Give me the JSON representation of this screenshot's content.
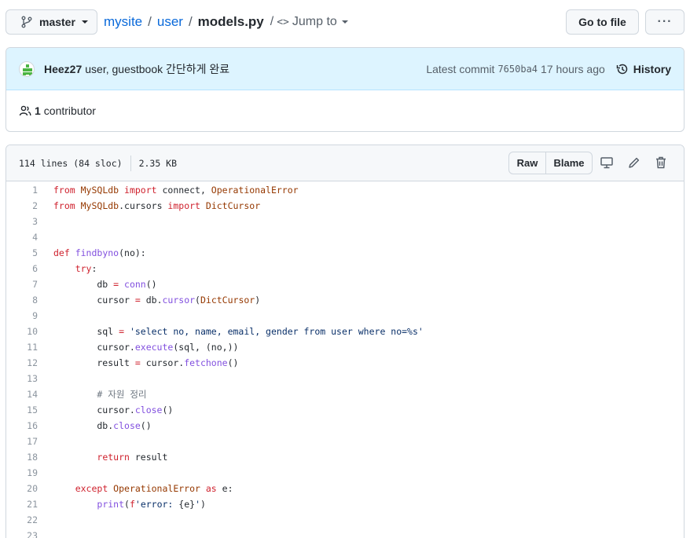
{
  "topbar": {
    "branch": "master",
    "repo": "mysite",
    "dir": "user",
    "file": "models.py",
    "jump_label": "Jump to",
    "goto_file": "Go to file",
    "more": "···"
  },
  "commit": {
    "author": "Heez27",
    "message": "user, guestbook 간단하게 완료",
    "latest_label": "Latest commit",
    "sha": "7650ba4",
    "time": "17 hours ago",
    "history_label": "History"
  },
  "contributors": {
    "count": "1",
    "label": "contributor"
  },
  "file": {
    "lines_info": "114 lines (84 sloc)",
    "size": "2.35 KB",
    "raw_label": "Raw",
    "blame_label": "Blame"
  },
  "code_lines": [
    {
      "n": "1",
      "t": [
        [
          "k",
          "from "
        ],
        [
          "n",
          "MySQLdb "
        ],
        [
          "k",
          "import "
        ],
        [
          "p",
          "connect, "
        ],
        [
          "n",
          "OperationalError"
        ]
      ]
    },
    {
      "n": "2",
      "t": [
        [
          "k",
          "from "
        ],
        [
          "n",
          "MySQLdb"
        ],
        [
          "p",
          "."
        ],
        [
          "p",
          "cursors "
        ],
        [
          "k",
          "import "
        ],
        [
          "n",
          "DictCursor"
        ]
      ]
    },
    {
      "n": "3",
      "t": []
    },
    {
      "n": "4",
      "t": []
    },
    {
      "n": "5",
      "t": [
        [
          "k",
          "def "
        ],
        [
          "f",
          "findbyno"
        ],
        [
          "p",
          "(no):"
        ]
      ]
    },
    {
      "n": "6",
      "t": [
        [
          "p",
          "    "
        ],
        [
          "k",
          "try"
        ],
        [
          "p",
          ":"
        ]
      ]
    },
    {
      "n": "7",
      "t": [
        [
          "p",
          "        db "
        ],
        [
          "k",
          "= "
        ],
        [
          "f",
          "conn"
        ],
        [
          "p",
          "()"
        ]
      ]
    },
    {
      "n": "8",
      "t": [
        [
          "p",
          "        cursor "
        ],
        [
          "k",
          "= "
        ],
        [
          "p",
          "db."
        ],
        [
          "f",
          "cursor"
        ],
        [
          "p",
          "("
        ],
        [
          "n",
          "DictCursor"
        ],
        [
          "p",
          ")"
        ]
      ]
    },
    {
      "n": "9",
      "t": []
    },
    {
      "n": "10",
      "t": [
        [
          "p",
          "        sql "
        ],
        [
          "k",
          "= "
        ],
        [
          "s",
          "'select no, name, email, gender from user where no=%s'"
        ]
      ]
    },
    {
      "n": "11",
      "t": [
        [
          "p",
          "        cursor."
        ],
        [
          "f",
          "execute"
        ],
        [
          "p",
          "(sql, (no,))"
        ]
      ]
    },
    {
      "n": "12",
      "t": [
        [
          "p",
          "        result "
        ],
        [
          "k",
          "= "
        ],
        [
          "p",
          "cursor."
        ],
        [
          "f",
          "fetchone"
        ],
        [
          "p",
          "()"
        ]
      ]
    },
    {
      "n": "13",
      "t": []
    },
    {
      "n": "14",
      "t": [
        [
          "p",
          "        "
        ],
        [
          "c",
          "# 자원 정리"
        ]
      ]
    },
    {
      "n": "15",
      "t": [
        [
          "p",
          "        cursor."
        ],
        [
          "f",
          "close"
        ],
        [
          "p",
          "()"
        ]
      ]
    },
    {
      "n": "16",
      "t": [
        [
          "p",
          "        db."
        ],
        [
          "f",
          "close"
        ],
        [
          "p",
          "()"
        ]
      ]
    },
    {
      "n": "17",
      "t": []
    },
    {
      "n": "18",
      "t": [
        [
          "p",
          "        "
        ],
        [
          "k",
          "return "
        ],
        [
          "p",
          "result"
        ]
      ]
    },
    {
      "n": "19",
      "t": []
    },
    {
      "n": "20",
      "t": [
        [
          "p",
          "    "
        ],
        [
          "k",
          "except "
        ],
        [
          "n",
          "OperationalError "
        ],
        [
          "k",
          "as "
        ],
        [
          "p",
          "e:"
        ]
      ]
    },
    {
      "n": "21",
      "t": [
        [
          "p",
          "        "
        ],
        [
          "f",
          "print"
        ],
        [
          "p",
          "("
        ],
        [
          "k",
          "f"
        ],
        [
          "s",
          "'error: "
        ],
        [
          "p",
          "{e}"
        ],
        [
          "s",
          "'"
        ],
        [
          "p",
          ")"
        ]
      ]
    },
    {
      "n": "22",
      "t": []
    },
    {
      "n": "23",
      "t": []
    }
  ]
}
